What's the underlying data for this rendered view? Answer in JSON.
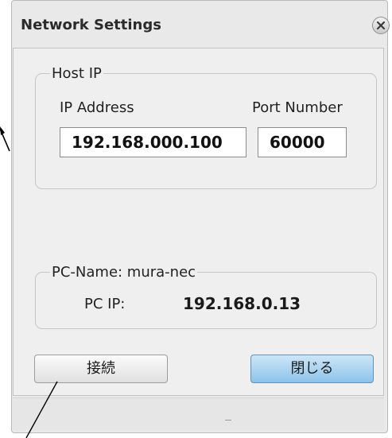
{
  "window": {
    "title": "Network Settings",
    "close_icon": "close-x-circle-icon"
  },
  "host_ip": {
    "group_label": "Host IP",
    "ip_label": "IP Address",
    "port_label": "Port Number",
    "ip_value": "192.168.000.100",
    "port_value": "60000"
  },
  "pc": {
    "group_label": "PC-Name: mura-nec",
    "ip_label": "PC IP:",
    "ip_value": "192.168.0.13"
  },
  "buttons": {
    "connect": "接続",
    "close": "閉じる"
  },
  "colors": {
    "dialog_bg": "#e9e9e9",
    "close_button_accent": "#8ec3ea"
  }
}
